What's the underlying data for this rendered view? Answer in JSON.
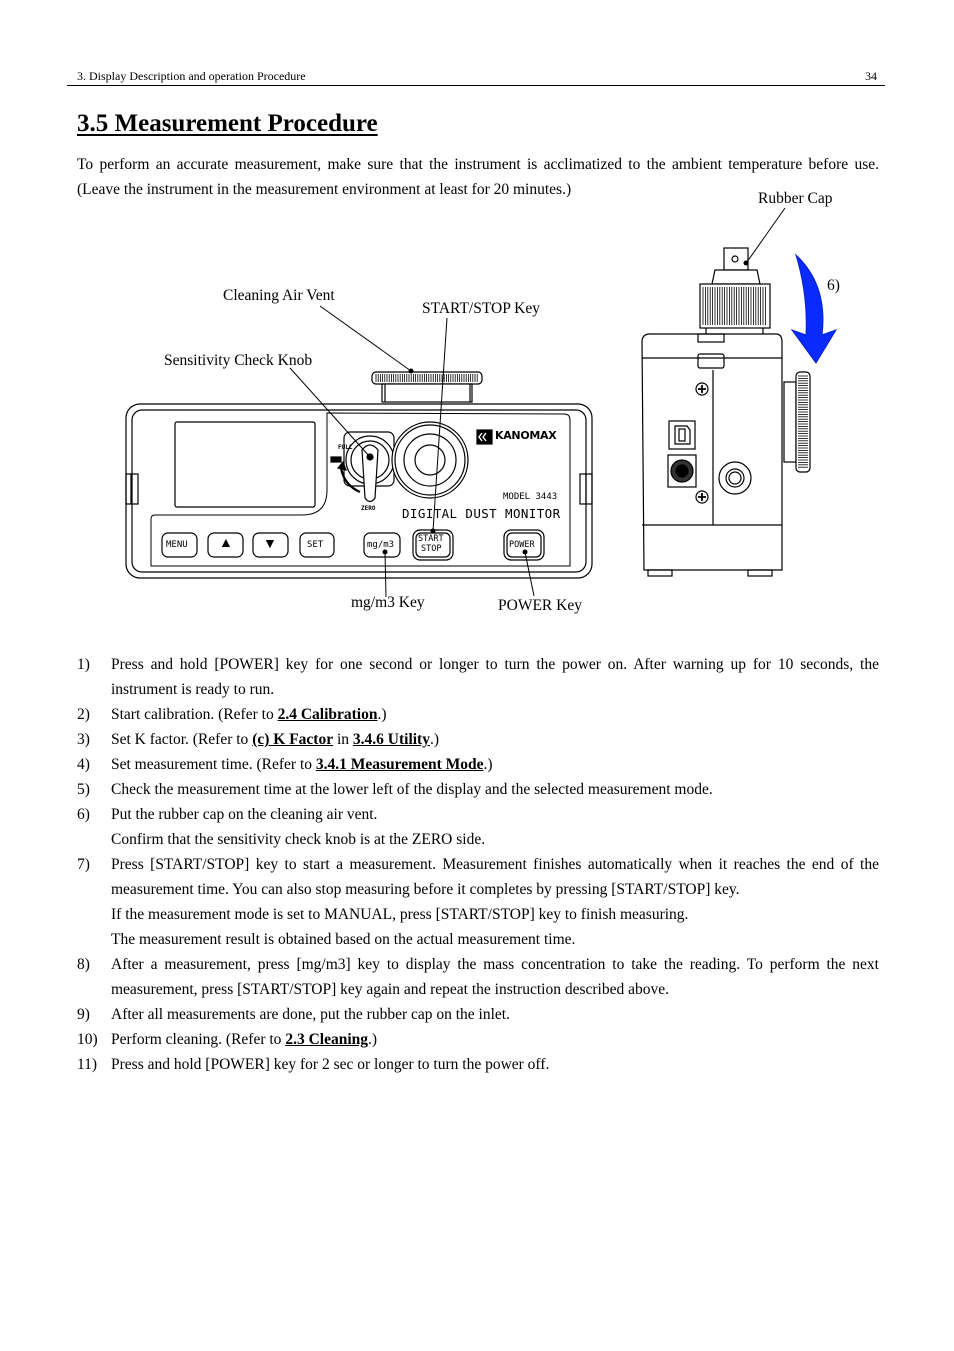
{
  "header": {
    "chapter": "3. Display Description and operation Procedure",
    "page_number": "34"
  },
  "title": "3.5 Measurement Procedure",
  "intro": "To perform an accurate measurement, make sure that the instrument is acclimatized to the ambient temperature before use. (Leave the instrument in the measurement environment at least for 20 minutes.)",
  "figure": {
    "callouts": {
      "cleaning_air_vent": "Cleaning Air Vent",
      "start_stop_key": "START/STOP Key",
      "sensitivity_check_knob": "Sensitivity Check Knob",
      "mg_m3_key": "mg/m3 Key",
      "power_key": "POWER Key",
      "rubber_cap": "Rubber Cap",
      "step_marker": "6)"
    },
    "device": {
      "brand": "KANOMAX",
      "model": "MODEL 3443",
      "product_name": "DIGITAL DUST MONITOR",
      "knob_full_label": "FULL",
      "knob_zero_label": "ZERO",
      "keys": {
        "menu": "MENU",
        "up": "▲",
        "down": "▼",
        "set": "SET",
        "mg_m3": "mg/m3",
        "start": "START",
        "stop": "STOP",
        "power": "POWER"
      }
    },
    "arrow_color": "#0a2bff"
  },
  "steps": [
    {
      "num": "1)",
      "parts": [
        {
          "t": "Press and hold [POWER] key for one second or longer to turn the power on. After warning up for 10 seconds, the instrument is ready to run."
        }
      ]
    },
    {
      "num": "2)",
      "parts": [
        {
          "t": "Start calibration. (Refer to "
        },
        {
          "ref": "2.4 Calibration"
        },
        {
          "t": ".)"
        }
      ]
    },
    {
      "num": "3)",
      "parts": [
        {
          "t": "Set K factor. (Refer to "
        },
        {
          "ref": "(c) K Factor"
        },
        {
          "t": " in "
        },
        {
          "ref": "3.4.6 Utility"
        },
        {
          "t": ".)"
        }
      ]
    },
    {
      "num": "4)",
      "parts": [
        {
          "t": "Set measurement time. (Refer to "
        },
        {
          "ref": "3.4.1 Measurement Mode"
        },
        {
          "t": ".)"
        }
      ]
    },
    {
      "num": "5)",
      "parts": [
        {
          "t": "Check the measurement time at the lower left of the display and the selected measurement mode."
        }
      ]
    },
    {
      "num": "6)",
      "parts": [
        {
          "t": "Put the rubber cap on the cleaning air vent."
        }
      ],
      "continuation": [
        "Confirm that the sensitivity check knob is at the ZERO side."
      ]
    },
    {
      "num": "7)",
      "parts": [
        {
          "t": "Press [START/STOP] key to start a measurement. Measurement finishes automatically when it reaches the end of the measurement time. You can also stop measuring before it completes by pressing [START/STOP] key."
        }
      ],
      "continuation": [
        "If the measurement mode is set to MANUAL, press [START/STOP] key to finish measuring.",
        "The measurement result is obtained based on the actual measurement time."
      ]
    },
    {
      "num": "8)",
      "parts": [
        {
          "t": "After a measurement, press [mg/m3] key to display the mass concentration to take the reading. To perform the next measurement, press [START/STOP] key again and repeat the instruction described above."
        }
      ]
    },
    {
      "num": "9)",
      "parts": [
        {
          "t": "After all measurements are done, put the rubber cap on the inlet."
        }
      ]
    },
    {
      "num": "10)",
      "parts": [
        {
          "t": "Perform cleaning. (Refer to "
        },
        {
          "ref": "2.3 Cleaning"
        },
        {
          "t": ".)"
        }
      ]
    },
    {
      "num": "11)",
      "parts": [
        {
          "t": "Press and hold [POWER] key for 2 sec or longer to turn the power off."
        }
      ]
    }
  ]
}
